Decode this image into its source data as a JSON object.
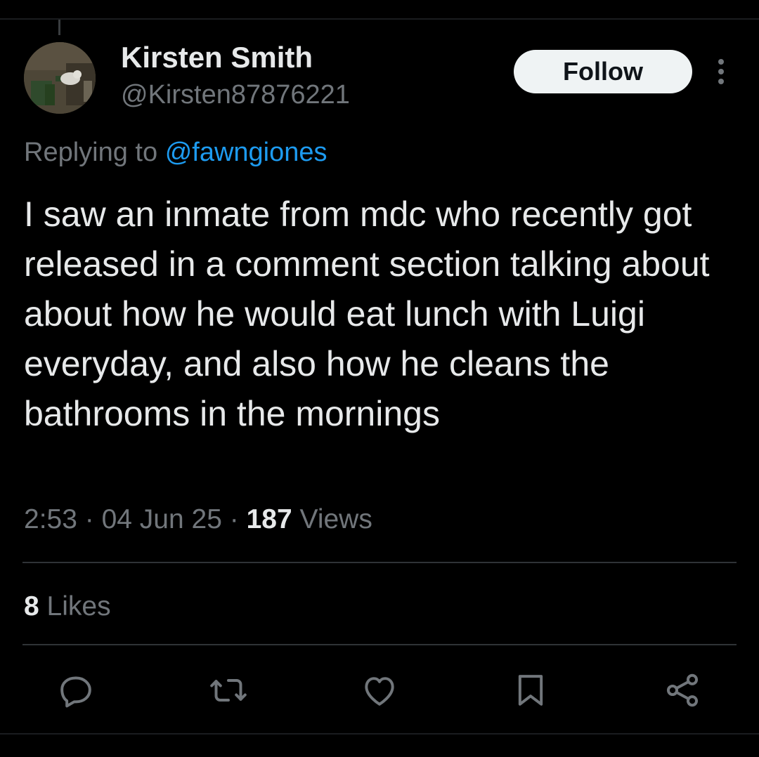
{
  "user": {
    "name": "Kirsten Smith",
    "handle": "@Kirsten87876221"
  },
  "follow_label": "Follow",
  "reply": {
    "prefix": "Replying to",
    "mention": "@fawngiones"
  },
  "tweet": {
    "text": "I saw an inmate from mdc who recently got released in a comment section talking about about how he would eat lunch with Luigi everyday, and also how he cleans the bathrooms in the mornings"
  },
  "meta": {
    "time": "2:53",
    "date": "04 Jun 25",
    "separator": "·",
    "views_count": "187",
    "views_label": "Views"
  },
  "likes": {
    "count": "8",
    "label": "Likes"
  },
  "actions": [
    {
      "name": "reply",
      "icon": "comment-icon"
    },
    {
      "name": "repost",
      "icon": "repost-icon"
    },
    {
      "name": "like",
      "icon": "heart-icon"
    },
    {
      "name": "bookmark",
      "icon": "bookmark-icon"
    },
    {
      "name": "share",
      "icon": "share-icon"
    }
  ],
  "colors": {
    "background": "#000000",
    "text": "#e7e9ea",
    "secondary": "#71767b",
    "link": "#1d9bf0",
    "divider": "#2f3336",
    "follow_bg": "#eff3f4"
  }
}
